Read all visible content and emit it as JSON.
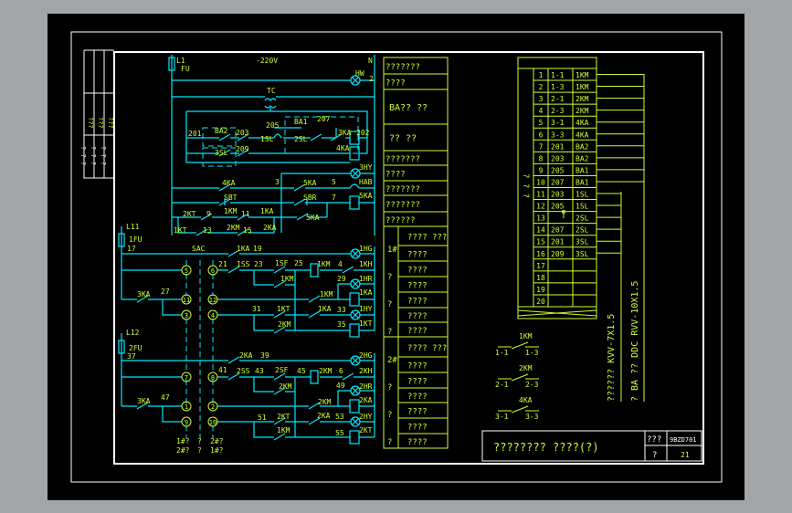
{
  "colors": {
    "background": "#000000",
    "frame": "#ffffff",
    "wire": "#00e8ff",
    "text": "#ccff33",
    "viewer_bg": "#a3a6a9"
  },
  "schematic": {
    "labels": [
      "L1",
      "FU",
      "-220V",
      "N",
      "HW",
      "2",
      "TC",
      "201",
      "BA2",
      "203",
      "1SL",
      "205",
      "BA1",
      "207",
      "2SL",
      "3KA",
      "202",
      "3SL",
      "209",
      "4KA",
      "3HY",
      "4KA",
      "3",
      "5KA",
      "5",
      "HAB",
      "SBT",
      "SBR",
      "7",
      "5KA",
      "2KT",
      "9",
      "1KM",
      "11",
      "1KA",
      "5KA",
      "1KT",
      "13",
      "2KM",
      "15",
      "2KA",
      "L11",
      "1FU",
      "17",
      "SAC",
      "1KA",
      "19",
      "1HG",
      "21",
      "1SS",
      "23",
      "1SF",
      "25",
      "1KM",
      "4",
      "1KH",
      "1KM",
      "29",
      "1HR",
      "3KA",
      "27",
      "1KM",
      "1KA",
      "31",
      "1KT",
      "1KA",
      "33",
      "1HY",
      "2KM",
      "35",
      "1KT",
      "L12",
      "2FU",
      "37",
      "2KA",
      "39",
      "2HG",
      "41",
      "2SS",
      "43",
      "2SF",
      "45",
      "2KM",
      "6",
      "2KH",
      "2KM",
      "49",
      "2HR",
      "3KA",
      "47",
      "2KM",
      "2KA",
      "51",
      "2KT",
      "2KA",
      "53",
      "2HY",
      "1KM",
      "55",
      "2KT",
      "1#?",
      "?",
      "2#?",
      "2#?",
      "?",
      "1#?"
    ],
    "terminals": [
      "5",
      "6",
      "11",
      "12",
      "3",
      "4",
      "7",
      "8",
      "1",
      "2",
      "9",
      "10"
    ]
  },
  "left_strip": {
    "rows": [
      "???",
      "? ? ?"
    ]
  },
  "function_table": {
    "top_rows": [
      "???????",
      "????",
      "BA?? ??",
      "?? ??",
      "???????",
      "????",
      "???????",
      "???????",
      "??????"
    ],
    "group1": {
      "label": "1#",
      "side": [
        "?",
        "?",
        "?"
      ],
      "rows": [
        "???? ???",
        "????",
        "????",
        "????",
        "????",
        "????",
        "????"
      ]
    },
    "group2": {
      "label": "2#",
      "side": [
        "?",
        "?",
        "?"
      ],
      "rows": [
        "???? ???",
        "????",
        "????",
        "????",
        "????",
        "????",
        "????"
      ]
    }
  },
  "terminal_table": {
    "side_label": "? ? ?",
    "rows": [
      [
        "1",
        "1-1",
        "1KM"
      ],
      [
        "2",
        "1-3",
        "1KM"
      ],
      [
        "3",
        "2-1",
        "2KM"
      ],
      [
        "4",
        "2-3",
        "2KM"
      ],
      [
        "5",
        "3-1",
        "4KA"
      ],
      [
        "6",
        "3-3",
        "4KA"
      ],
      [
        "7",
        "201",
        "BA2"
      ],
      [
        "8",
        "203",
        "BA2"
      ],
      [
        "9",
        "205",
        "BA1"
      ],
      [
        "10",
        "207",
        "BA1"
      ],
      [
        "11",
        "203",
        "1SL"
      ],
      [
        "12",
        "205",
        "1SL"
      ],
      [
        "13",
        "",
        "2SL"
      ],
      [
        "14",
        "207",
        "2SL"
      ],
      [
        "15",
        "201",
        "3SL"
      ],
      [
        "16",
        "209",
        "3SL"
      ],
      [
        "17",
        "",
        ""
      ],
      [
        "18",
        "",
        ""
      ],
      [
        "19",
        "",
        ""
      ],
      [
        "20",
        "",
        ""
      ]
    ]
  },
  "cables": {
    "cable1": "?????? KVV-7X1.5",
    "cable2": "? BA ?? DDC RVV-10X1.5"
  },
  "contacts": [
    {
      "name": "1KM",
      "left": "1-1",
      "right": "1-3"
    },
    {
      "name": "2KM",
      "left": "2-1",
      "right": "2-3"
    },
    {
      "name": "4KA",
      "left": "3-1",
      "right": "3-3"
    }
  ],
  "title_block": {
    "title": "????????  ????(?)",
    "label1": "???",
    "drawing_no": "9BZD701",
    "label2": "?",
    "sheet": "21"
  }
}
